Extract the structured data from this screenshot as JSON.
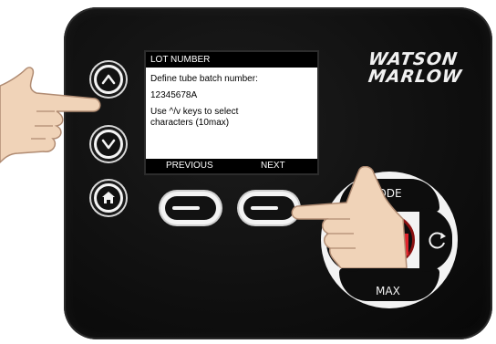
{
  "screen": {
    "title": "LOT NUMBER",
    "prompt": "Define tube batch number:",
    "value": "12345678A",
    "hint_line1": "Use ^/v keys to select",
    "hint_line2": "characters (10max)",
    "soft_left": "PREVIOUS",
    "soft_right": "NEXT"
  },
  "logo": {
    "line1": "WATSON",
    "line2": "MARLOW"
  },
  "ring": {
    "top_label": "MODE",
    "bottom_label": "MAX"
  },
  "icons": [
    "up-arrow-icon",
    "down-arrow-icon",
    "home-icon",
    "refresh-icon",
    "stop-icon"
  ],
  "colors": {
    "panel": "#0f0f0f",
    "stop_red": "#e0242c",
    "screen_bg": "#ffffff"
  }
}
